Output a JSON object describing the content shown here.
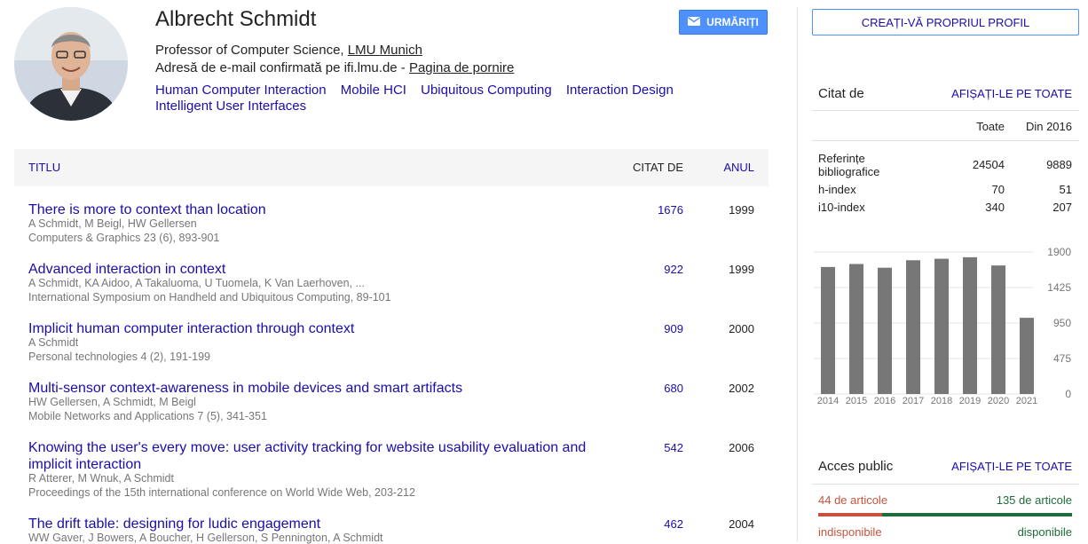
{
  "profile": {
    "name": "Albrecht Schmidt",
    "affiliation_prefix": "Professor of Computer Science, ",
    "affiliation_link": "LMU Munich",
    "email_text": "Adresă de e-mail confirmată pe ifi.lmu.de - ",
    "homepage_link": "Pagina de pornire",
    "interests": [
      "Human Computer Interaction",
      "Mobile HCI",
      "Ubiquitous Computing",
      "Interaction Design",
      "Intelligent User Interfaces"
    ],
    "follow_label": "URMĂRIȚI"
  },
  "table": {
    "col_title": "TITLU",
    "col_cited": "CITAT DE",
    "col_year": "ANUL",
    "articles": [
      {
        "title": "There is more to context than location",
        "authors": "A Schmidt, M Beigl, HW Gellersen",
        "venue": "Computers & Graphics 23 (6), 893-901",
        "cites": "1676",
        "year": "1999"
      },
      {
        "title": "Advanced interaction in context",
        "authors": "A Schmidt, KA Aidoo, A Takaluoma, U Tuomela, K Van Laerhoven, ...",
        "venue": "International Symposium on Handheld and Ubiquitous Computing, 89-101",
        "cites": "922",
        "year": "1999"
      },
      {
        "title": "Implicit human computer interaction through context",
        "authors": "A Schmidt",
        "venue": "Personal technologies 4 (2), 191-199",
        "cites": "909",
        "year": "2000"
      },
      {
        "title": "Multi-sensor context-awareness in mobile devices and smart artifacts",
        "authors": "HW Gellersen, A Schmidt, M Beigl",
        "venue": "Mobile Networks and Applications 7 (5), 341-351",
        "cites": "680",
        "year": "2002"
      },
      {
        "title": "Knowing the user's every move: user activity tracking for website usability evaluation and implicit interaction",
        "authors": "R Atterer, M Wnuk, A Schmidt",
        "venue": "Proceedings of the 15th international conference on World Wide Web, 203-212",
        "cites": "542",
        "year": "2006"
      },
      {
        "title": "The drift table: designing for ludic engagement",
        "authors": "WW Gaver, J Bowers, A Boucher, H Gellerson, S Pennington, A Schmidt",
        "venue": "",
        "cites": "462",
        "year": "2004"
      }
    ]
  },
  "sidebar": {
    "create_profile_label": "CREAȚI-VĂ PROPRIUL PROFIL",
    "cited_by": {
      "heading": "Citat de",
      "show_all": "AFIȘAȚI-LE PE TOATE",
      "col_all": "Toate",
      "col_since": "Din 2016",
      "rows": [
        {
          "label": "Referințe bibliografice",
          "all": "24504",
          "since": "9889"
        },
        {
          "label": "h-index",
          "all": "70",
          "since": "51"
        },
        {
          "label": "i10-index",
          "all": "340",
          "since": "207"
        }
      ]
    },
    "open_access": {
      "heading": "Acces public",
      "show_all": "AFIȘAȚI-LE PE TOATE",
      "unavailable_count": "44 de articole",
      "available_count": "135 de articole",
      "unavailable_label": "indisponibile",
      "available_label": "disponibile",
      "unavailable_color": "#c5543b",
      "available_color": "#1e6c3a"
    }
  },
  "chart_data": {
    "type": "bar",
    "categories": [
      "2014",
      "2015",
      "2016",
      "2017",
      "2018",
      "2019",
      "2020",
      "2021"
    ],
    "values": [
      1700,
      1740,
      1690,
      1790,
      1810,
      1830,
      1720,
      1020
    ],
    "yticks": [
      0,
      475,
      950,
      1425,
      1900
    ],
    "ylim": [
      0,
      1900
    ],
    "bar_color": "#777777"
  }
}
